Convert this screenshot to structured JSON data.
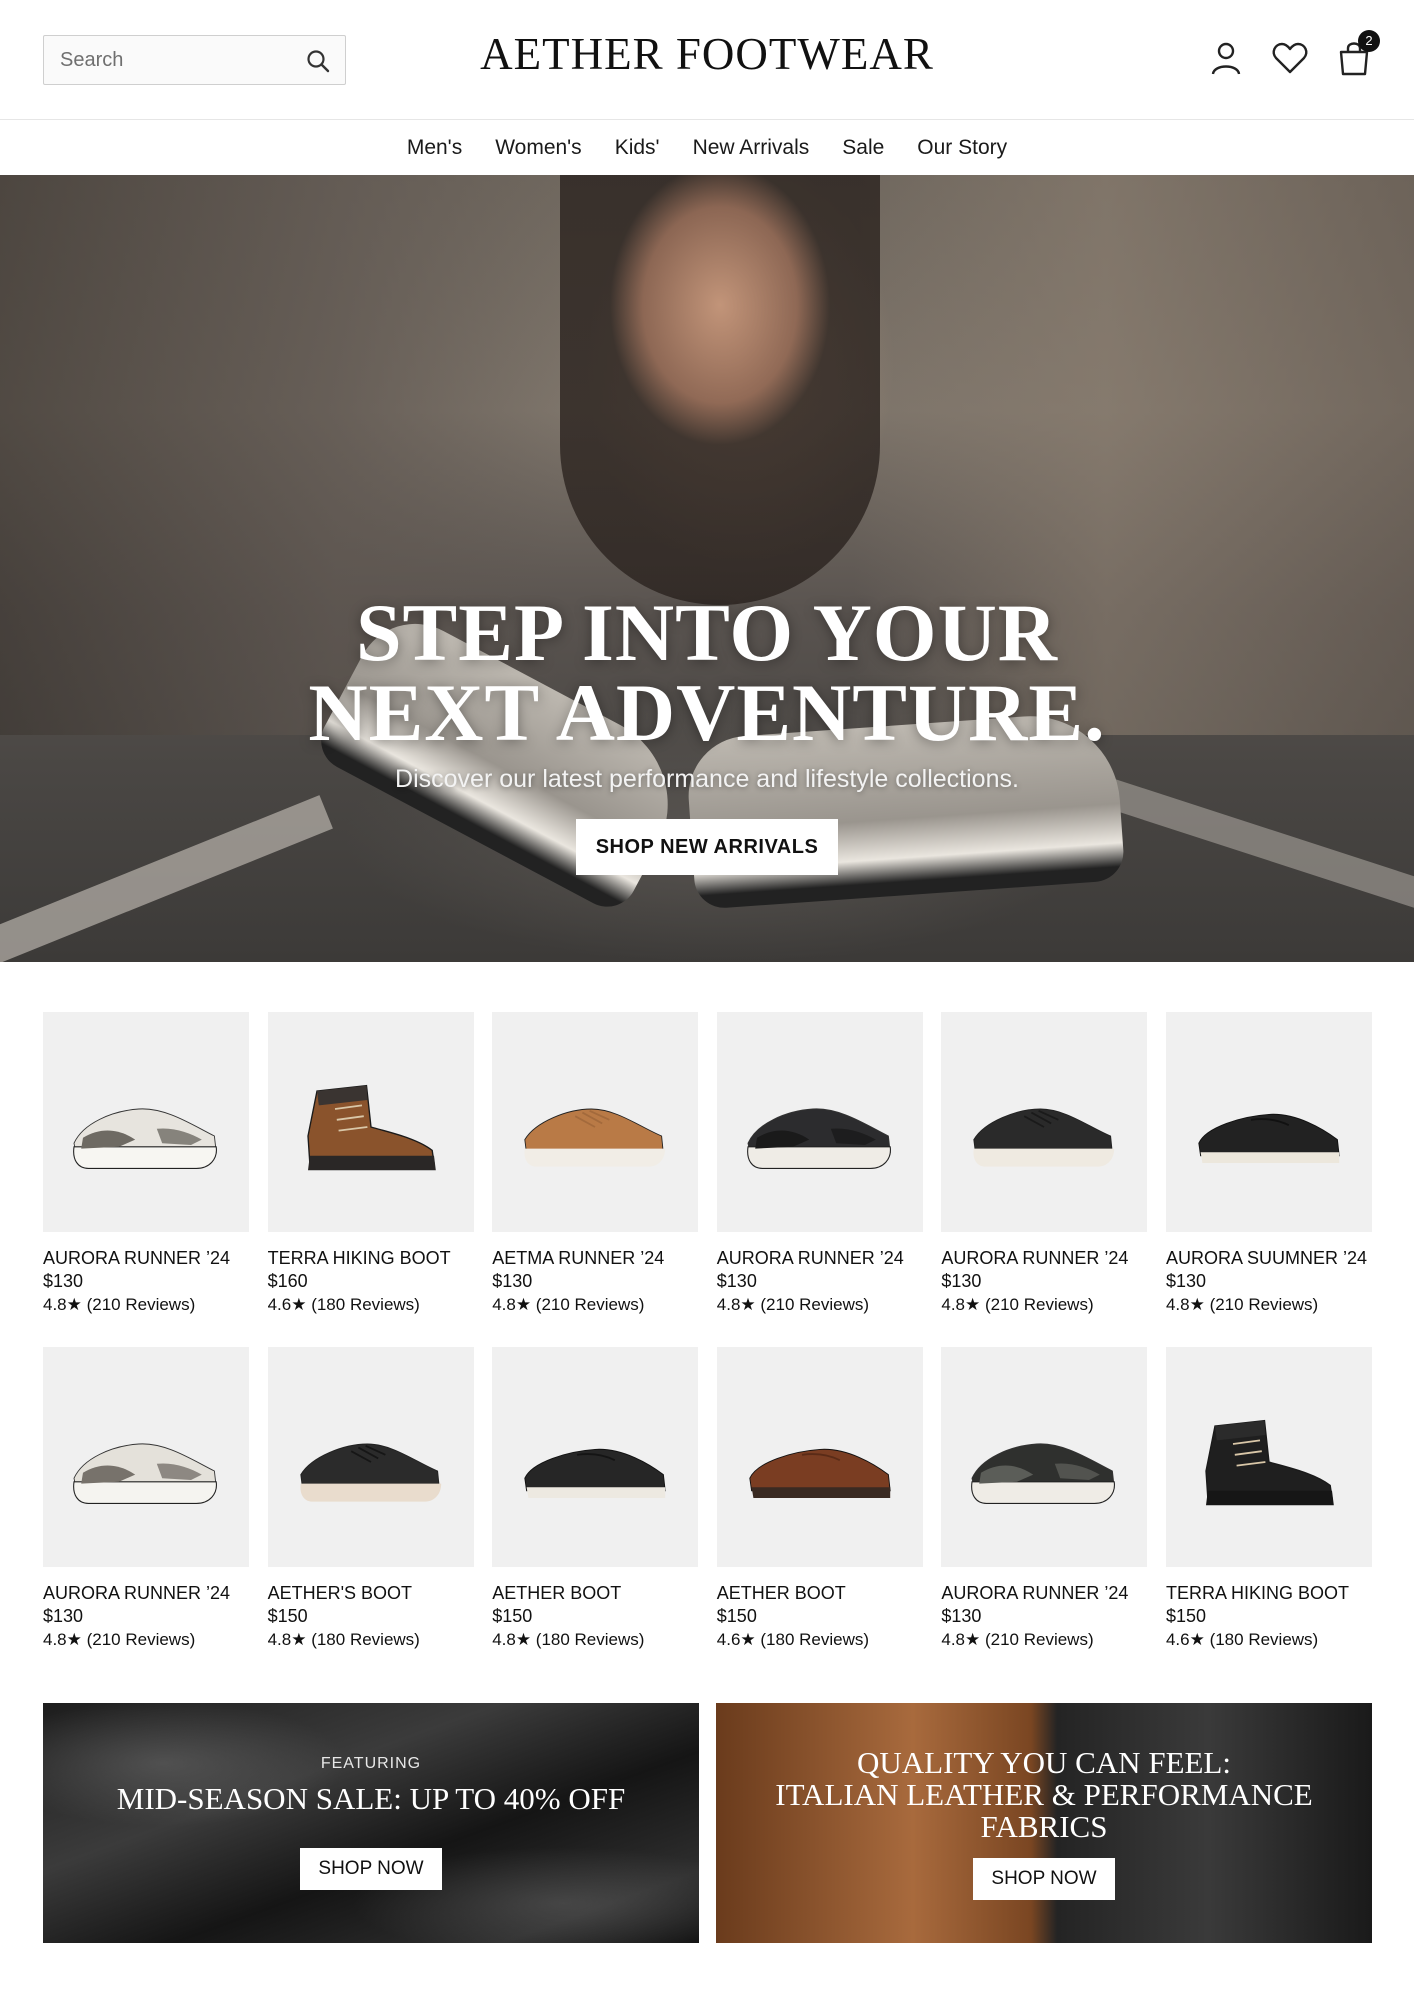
{
  "header": {
    "search_placeholder": "Search",
    "logo": "AETHER FOOTWEAR",
    "cart_count": "2"
  },
  "nav": [
    "Men's",
    "Women's",
    "Kids'",
    "New Arrivals",
    "Sale",
    "Our Story"
  ],
  "hero": {
    "title_line1": "STEP INTO YOUR",
    "title_line2": "NEXT ADVENTURE.",
    "subtitle": "Discover our latest performance and lifestyle collections.",
    "cta": "SHOP NEW ARRIVALS"
  },
  "products_row1": [
    {
      "name": "AURORA RUNNER ’24",
      "price": "$130",
      "rating": "4.8★ (210 Reviews)",
      "shoe": "runner",
      "color": "#e7e4de",
      "accent": "#6e6a63",
      "sole": "#f7f6f2"
    },
    {
      "name": "TERRA HIKING BOOT",
      "price": "$160",
      "rating": "4.6★ (180 Reviews)",
      "shoe": "boot",
      "color": "#8a532c",
      "accent": "#3a3431",
      "sole": "#2a2726"
    },
    {
      "name": "AETMA RUNNER ’24",
      "price": "$130",
      "rating": "4.8★ (210 Reviews)",
      "shoe": "sneaker",
      "color": "#b97a46",
      "accent": "#a36a3c",
      "sole": "#f1ede6"
    },
    {
      "name": "AURORA RUNNER ’24",
      "price": "$130",
      "rating": "4.8★ (210 Reviews)",
      "shoe": "runner",
      "color": "#2c2c2e",
      "accent": "#1a1a1a",
      "sole": "#efece6"
    },
    {
      "name": "AURORA RUNNER ’24",
      "price": "$130",
      "rating": "4.8★ (210 Reviews)",
      "shoe": "sneaker",
      "color": "#2a2a2a",
      "accent": "#1a1a1a",
      "sole": "#efeae1"
    },
    {
      "name": "AURORA SUUMNER ’24",
      "price": "$130",
      "rating": "4.8★ (210 Reviews)",
      "shoe": "dress",
      "color": "#222222",
      "accent": "#111111",
      "sole": "#ece7dc"
    }
  ],
  "products_row2": [
    {
      "name": "AURORA RUNNER ’24",
      "price": "$130",
      "rating": "4.8★ (210 Reviews)",
      "shoe": "runner",
      "color": "#e4e1da",
      "accent": "#77726b",
      "sole": "#f5f4f0"
    },
    {
      "name": "AETHER'S BOOT",
      "price": "$150",
      "rating": "4.8★ (180 Reviews)",
      "shoe": "sneaker",
      "color": "#2b2b2b",
      "accent": "#161616",
      "sole": "#e9dccd"
    },
    {
      "name": "AETHER BOOT",
      "price": "$150",
      "rating": "4.8★ (180 Reviews)",
      "shoe": "dress",
      "color": "#262626",
      "accent": "#141414",
      "sole": "#ede9e1"
    },
    {
      "name": "AETHER BOOT",
      "price": "$150",
      "rating": "4.6★ (180 Reviews)",
      "shoe": "dress",
      "color": "#7a3d22",
      "accent": "#5a2b17",
      "sole": "#3a2a22"
    },
    {
      "name": "AURORA RUNNER ’24",
      "price": "$130",
      "rating": "4.8★ (210 Reviews)",
      "shoe": "runner",
      "color": "#2f302e",
      "accent": "#5b5d58",
      "sole": "#efece6"
    },
    {
      "name": "TERRA HIKING BOOT",
      "price": "$150",
      "rating": "4.6★ (180 Reviews)",
      "shoe": "boot",
      "color": "#1f1f1f",
      "accent": "#2b2b2b",
      "sole": "#161616"
    }
  ],
  "promos": {
    "sale": {
      "kicker": "FEATURING",
      "title": "MID-SEASON SALE: UP TO 40% OFF",
      "cta": "SHOP NOW"
    },
    "quality": {
      "title_line1": "QUALITY YOU CAN FEEL:",
      "title_line2": "ITALIAN LEATHER & PERFORMANCE",
      "title_line3": "FABRICS",
      "cta": "SHOP NOW"
    }
  }
}
